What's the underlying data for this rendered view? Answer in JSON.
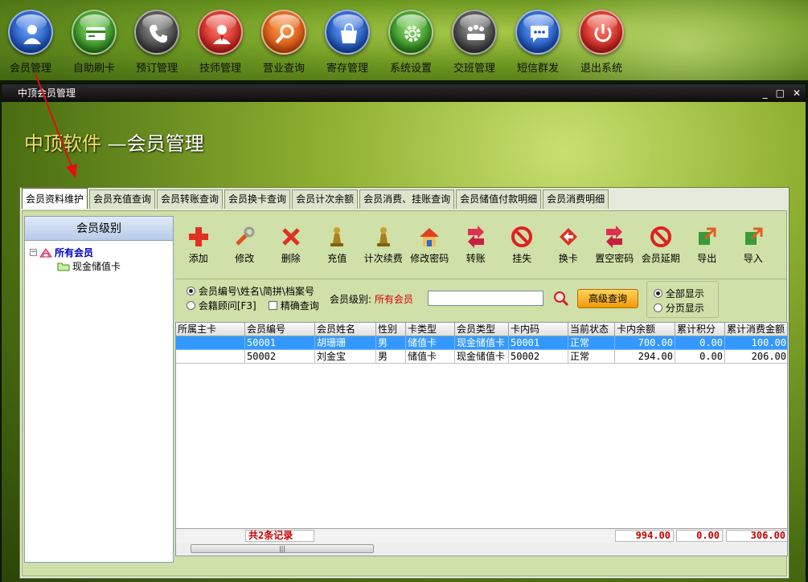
{
  "launcher": [
    {
      "label": "会员管理",
      "icon": "user-icon",
      "color": "blue"
    },
    {
      "label": "自助刷卡",
      "icon": "card-icon",
      "color": "green"
    },
    {
      "label": "预订管理",
      "icon": "phone-icon",
      "color": "gray"
    },
    {
      "label": "技师管理",
      "icon": "technician-icon",
      "color": "red"
    },
    {
      "label": "营业查询",
      "icon": "magnifier-icon",
      "color": "orange"
    },
    {
      "label": "寄存管理",
      "icon": "bag-icon",
      "color": "blue"
    },
    {
      "label": "系统设置",
      "icon": "gear-icon",
      "color": "green"
    },
    {
      "label": "交班管理",
      "icon": "meeting-icon",
      "color": "gray"
    },
    {
      "label": "短信群发",
      "icon": "message-icon",
      "color": "blue"
    },
    {
      "label": "退出系统",
      "icon": "power-icon",
      "color": "red"
    }
  ],
  "window": {
    "title": "中顶会员管理",
    "controls": {
      "minimize": "_",
      "maximize": "□",
      "close": "✕"
    }
  },
  "app_title": {
    "brand": "中顶软件",
    "rest": " —会员管理"
  },
  "tabs": [
    {
      "label": "会员资料维护",
      "active": true
    },
    {
      "label": "会员充值查询"
    },
    {
      "label": "会员转账查询"
    },
    {
      "label": "会员换卡查询"
    },
    {
      "label": "会员计次余额"
    },
    {
      "label": "会员消费、挂账查询"
    },
    {
      "label": "会员储值付款明细"
    },
    {
      "label": "会员消费明细"
    }
  ],
  "tree": {
    "header": "会员级别",
    "expander": "−",
    "root": "所有会员",
    "children": [
      "现金储值卡"
    ]
  },
  "toolbar": [
    {
      "label": "添加",
      "icon": "add-icon"
    },
    {
      "label": "修改",
      "icon": "wrench-icon"
    },
    {
      "label": "删除",
      "icon": "delete-icon"
    },
    {
      "label": "充值",
      "icon": "pawn-icon"
    },
    {
      "label": "计次续费",
      "icon": "pawn-icon"
    },
    {
      "label": "修改密码",
      "icon": "house-icon"
    },
    {
      "label": "转账",
      "icon": "transfer-icon"
    },
    {
      "label": "挂失",
      "icon": "ban-icon"
    },
    {
      "label": "换卡",
      "icon": "swap-icon"
    },
    {
      "label": "置空密码",
      "icon": "transfer-icon"
    },
    {
      "label": "会员延期",
      "icon": "ban-icon"
    },
    {
      "label": "导出",
      "icon": "export-icon"
    },
    {
      "label": "导入",
      "icon": "import-icon"
    }
  ],
  "search": {
    "option_member": "会员编号\\姓名\\简拼\\档案号",
    "option_advisor": "会籍顾问[F3]",
    "precise": "精确查询",
    "level_label": "会员级别:",
    "level_value": "所有会员",
    "input_value": "",
    "advanced_button": "高级查询",
    "display_all": "全部显示",
    "display_paged": "分页显示"
  },
  "grid": {
    "columns": [
      "所属主卡",
      "会员编号",
      "会员姓名",
      "性别",
      "卡类型",
      "会员类型",
      "卡内码",
      "当前状态",
      "卡内余额",
      "累计积分",
      "累计消费金额"
    ],
    "rows": [
      [
        "",
        "50001",
        "胡珊珊",
        "男",
        "储值卡",
        "现金储值卡",
        "50001",
        "正常",
        "700.00",
        "0.00",
        "100.00"
      ],
      [
        "",
        "50002",
        "刘金宝",
        "男",
        "储值卡",
        "现金储值卡",
        "50002",
        "正常",
        "294.00",
        "0.00",
        "206.00"
      ]
    ],
    "selected_row": 0,
    "footer": {
      "count": "共2条记录",
      "balance_total": "994.00",
      "points_total": "0.00",
      "spend_total": "306.00"
    },
    "scroll_thumb": "|||"
  },
  "colors": {
    "accent_red": "#d80000",
    "selection": "#3399ff",
    "button_orange": "#f29a0a"
  }
}
